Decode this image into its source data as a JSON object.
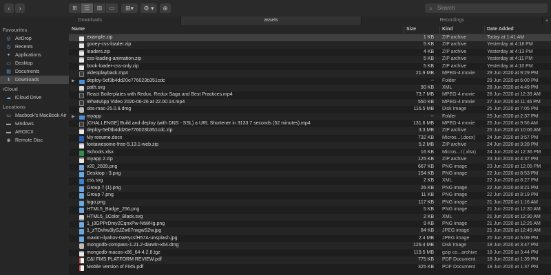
{
  "toolbar": {
    "back": "‹",
    "forward": "›",
    "action": "⚙ ▾",
    "share": "⊕",
    "search_placeholder": "Search"
  },
  "tabs": [
    {
      "label": "Downloads",
      "active": false
    },
    {
      "label": "assets",
      "active": true
    },
    {
      "label": "Recordings",
      "active": false
    }
  ],
  "sidebar": {
    "favourites_label": "Favourites",
    "favourites": [
      {
        "label": "AirDrop",
        "icon": "airdrop-icon",
        "glyph": "◎"
      },
      {
        "label": "Recents",
        "icon": "clock-icon",
        "glyph": "◷"
      },
      {
        "label": "Applications",
        "icon": "applications-icon",
        "glyph": "✦"
      },
      {
        "label": "Desktop",
        "icon": "desktop-icon",
        "glyph": "▭"
      },
      {
        "label": "Documents",
        "icon": "documents-icon",
        "glyph": "▤"
      },
      {
        "label": "Downloads",
        "icon": "downloads-icon",
        "glyph": "⬇",
        "selected": true
      }
    ],
    "icloud_label": "iCloud",
    "icloud": [
      {
        "label": "iCloud Drive",
        "icon": "cloud-icon",
        "glyph": "☁"
      }
    ],
    "locations_label": "Locations",
    "locations": [
      {
        "label": "Macbook's MacBook Air",
        "icon": "laptop-icon",
        "glyph": "▭"
      },
      {
        "label": "windows",
        "icon": "drive-icon",
        "glyph": "▬"
      },
      {
        "label": "AROICX",
        "icon": "drive-icon",
        "glyph": "▬"
      },
      {
        "label": "Remote Disc",
        "icon": "disc-icon",
        "glyph": "◉"
      }
    ]
  },
  "columns": {
    "name": "Name",
    "size": "Size",
    "kind": "Kind",
    "date": "Date Added"
  },
  "files": [
    {
      "name": "example.zip",
      "size": "1 KB",
      "kind": "ZIP archive",
      "date": "Today at 1:41 AM",
      "icon": "zip",
      "selected": true
    },
    {
      "name": "gooey-css-loader.zip",
      "size": "5 KB",
      "kind": "ZIP archive",
      "date": "Yesterday at 4:18 PM",
      "icon": "zip"
    },
    {
      "name": "loaders.zip",
      "size": "4 KB",
      "kind": "ZIP archive",
      "date": "Yesterday at 4:13 PM",
      "icon": "zip"
    },
    {
      "name": "css-loading-animation.zip",
      "size": "5 KB",
      "kind": "ZIP archive",
      "date": "Yesterday at 4:11 PM",
      "icon": "zip"
    },
    {
      "name": "book-loader-css-only.zip",
      "size": "5 KB",
      "kind": "ZIP archive",
      "date": "Yesterday at 4:10 PM",
      "icon": "zip"
    },
    {
      "name": "videoplayback.mp4",
      "size": "21.9 MB",
      "kind": "MPEG-4 movie",
      "date": "29 Jun 2020 at 9:29 PM",
      "icon": "movie"
    },
    {
      "name": "deploy-5ef3b4dd20e776023b351cdc",
      "size": "--",
      "kind": "Folder",
      "date": "29 Jun 2020 at 6:00 PM",
      "icon": "folder",
      "expandable": true
    },
    {
      "name": "path.svg",
      "size": "90 KB",
      "kind": "XML",
      "date": "28 Jun 2020 at 4:49 PM",
      "icon": "xml"
    },
    {
      "name": "React Boilerplates with Redux, Redux Saga and Best Practices.mp4",
      "size": "73.7 MB",
      "kind": "MPEG-4 movie",
      "date": "28 Jun 2020 at 12:39 AM",
      "icon": "movie"
    },
    {
      "name": "WhatsApp Video 2020-06-26 at 22.00.14.mp4",
      "size": "550 KB",
      "kind": "MPEG-4 movie",
      "date": "27 Jun 2020 at 11:46 PM",
      "icon": "movie"
    },
    {
      "name": "obs-mac-25.0.8.dmg",
      "size": "116.5 MB",
      "kind": "Disk Image",
      "date": "25 Jun 2020 at 7:05 PM",
      "icon": "disk"
    },
    {
      "name": "myapp",
      "size": "--",
      "kind": "Folder",
      "date": "25 Jun 2020 at 2:37 PM",
      "icon": "folder",
      "expandable": true
    },
    {
      "name": "[CHALLENGE] Build and deploy (with DNS - SSL) a URL Shortener in 3133.7 seconds (52 minutes).mp4",
      "size": "131.6 MB",
      "kind": "MPEG-4 movie",
      "date": "25 Jun 2020 at 9:56 AM",
      "icon": "movie"
    },
    {
      "name": "deploy-5ef3b4dd20e776023b351cdc.zip",
      "size": "3.3 MB",
      "kind": "ZIP archive",
      "date": "25 Jun 2020 at 10:06 AM",
      "icon": "zip"
    },
    {
      "name": "My resume.docx",
      "size": "732 KB",
      "kind": "Micros...(.docx)",
      "date": "24 Jun 2020 at 3:57 PM",
      "icon": "word"
    },
    {
      "name": "fontawesome-free-5.13.1-web.zip",
      "size": "5.2 MB",
      "kind": "ZIP archive",
      "date": "24 Jun 2020 at 3:28 PM",
      "icon": "zip"
    },
    {
      "name": "Schools.xlsx",
      "size": "16 KB",
      "kind": "Micros...t (.xlsx)",
      "date": "24 Jun 2020 at 12:36 PM",
      "icon": "xls"
    },
    {
      "name": "myapp 2.zip",
      "size": "125 KB",
      "kind": "ZIP archive",
      "date": "23 Jun 2020 at 4:37 PM",
      "icon": "zip"
    },
    {
      "name": "v20_2839.png",
      "size": "667 KB",
      "kind": "PNG image",
      "date": "23 Jun 2020 at 12:05 PM",
      "icon": "img"
    },
    {
      "name": "Desktop - 3.png",
      "size": "154 KB",
      "kind": "PNG image",
      "date": "22 Jun 2020 at 8:53 PM",
      "icon": "img"
    },
    {
      "name": "css.svg",
      "size": "2 KB",
      "kind": "XML",
      "date": "22 Jun 2020 at 8:27 PM",
      "icon": "css"
    },
    {
      "name": "Group 7 (1).png",
      "size": "26 KB",
      "kind": "PNG image",
      "date": "22 Jun 2020 at 8:21 PM",
      "icon": "img"
    },
    {
      "name": "Group 7.png",
      "size": "11 KB",
      "kind": "PNG image",
      "date": "22 Jun 2020 at 8:19 PM",
      "icon": "img"
    },
    {
      "name": "logo.png",
      "size": "117 KB",
      "kind": "PNG image",
      "date": "21 Jun 2020 at 1:16 AM",
      "icon": "img"
    },
    {
      "name": "HTML5_Badge_256.png",
      "size": "5 KB",
      "kind": "PNG image",
      "date": "21 Jun 2020 at 12:30 AM",
      "icon": "img"
    },
    {
      "name": "HTML5_1Color_Black.svg",
      "size": "2 KB",
      "kind": "XML",
      "date": "21 Jun 2020 at 12:30 AM",
      "icon": "xml"
    },
    {
      "name": "1_j3GPPrDmy2CqnxPw-NtWHg.png",
      "size": "9 KB",
      "kind": "PNG image",
      "date": "21 Jun 2020 at 12:26 AM",
      "icon": "img"
    },
    {
      "name": "1_zTDvhw3lySJZw07nxgwS2w.jpg",
      "size": "84 KB",
      "kind": "JPEG image",
      "date": "21 Jun 2020 at 12:49 AM",
      "icon": "img"
    },
    {
      "name": "maxim-ilyahov-0aRycsfH57A-unsplash.jpg",
      "size": "2.4 MB",
      "kind": "JPEG image",
      "date": "20 Jun 2020 at 5:09 PM",
      "icon": "img"
    },
    {
      "name": "mongodb-compass-1.21.2-darwin-x64.dmg",
      "size": "126.4 MB",
      "kind": "Disk Image",
      "date": "18 Jun 2020 at 3:47 PM",
      "icon": "disk"
    },
    {
      "name": "mongodb-macos-x86_64-4.2.8.tgz",
      "size": "119.5 MB",
      "kind": "gzip co...archive",
      "date": "18 Jun 2020 at 3:44 PM",
      "icon": "zip"
    },
    {
      "name": "C&I FMS PLATFORM REVIEW.pdf",
      "size": "775 KB",
      "kind": "PDF Document",
      "date": "18 Jun 2020 at 1:39 PM",
      "icon": "pdf"
    },
    {
      "name": "Mobile Version of FMS.pdf",
      "size": "325 KB",
      "kind": "PDF Document",
      "date": "18 Jun 2020 at 1:37 PM",
      "icon": "pdf"
    }
  ]
}
